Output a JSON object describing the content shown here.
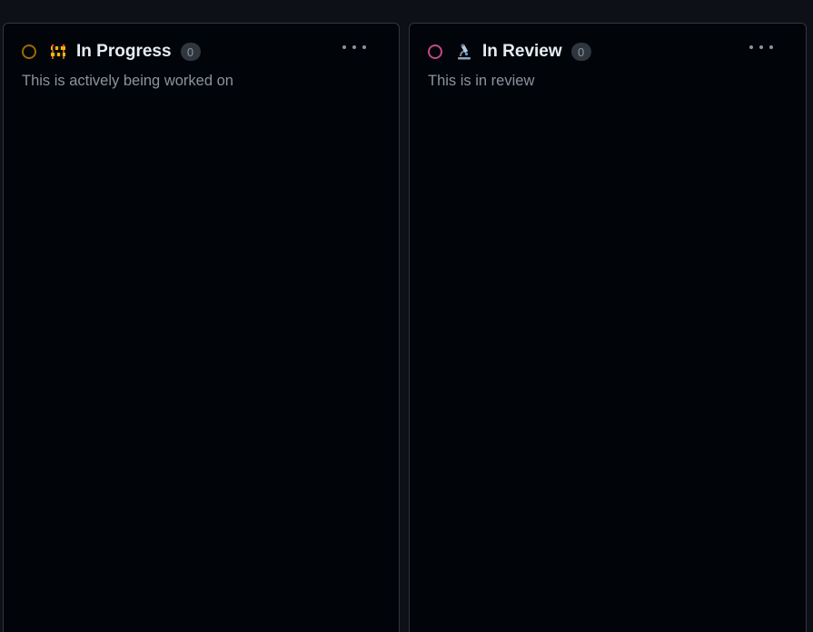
{
  "columns": [
    {
      "title": "In Progress",
      "count": "0",
      "description": "This is actively being worked on",
      "status_color": "#9e6a03",
      "icon": "construction-icon"
    },
    {
      "title": "In Review",
      "count": "0",
      "description": "This is in review",
      "status_color": "#bf4b8a",
      "icon": "microscope-icon"
    }
  ],
  "theme": {
    "page_bg": "#0d1117",
    "column_bg": "#010409",
    "border": "#30363d",
    "text_primary": "#e6edf3",
    "text_muted": "#8b949e"
  }
}
